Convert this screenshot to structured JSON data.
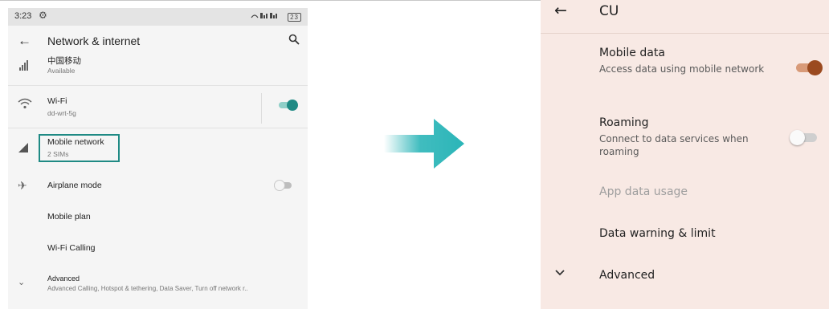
{
  "left_screen": {
    "status": {
      "time": "3:23",
      "icons": "⚓ ▐▐▌▐▐▌",
      "battery": "23"
    },
    "header": {
      "title": "Network & internet"
    },
    "items": {
      "sim": {
        "title": "中国移动",
        "subtitle": "Available"
      },
      "wifi": {
        "title": "Wi-Fi",
        "subtitle": "dd-wrt-5g",
        "toggle_on": true
      },
      "mobile": {
        "title": "Mobile network",
        "subtitle": "2 SIMs"
      },
      "airplane": {
        "title": "Airplane mode",
        "toggle_on": false
      },
      "mobile_plan": {
        "title": "Mobile plan"
      },
      "wifi_calling": {
        "title": "Wi-Fi Calling"
      },
      "advanced": {
        "title": "Advanced",
        "subtitle": "Advanced Calling, Hotspot & tethering, Data Saver, Turn off network r.."
      }
    }
  },
  "right_screen": {
    "header": {
      "title": "CU"
    },
    "mobile_data": {
      "title": "Mobile data",
      "subtitle": "Access data using mobile network",
      "toggle_on": true
    },
    "roaming": {
      "title": "Roaming",
      "subtitle": "Connect to data services when roaming",
      "toggle_on": false
    },
    "app_data_usage": {
      "title": "App data usage"
    },
    "data_warning": {
      "title": "Data warning & limit"
    },
    "advanced": {
      "title": "Advanced"
    }
  },
  "colors": {
    "teal_accent": "#1f8a84",
    "arrow": "#2bb5b8",
    "brown_toggle": "#9b4a1f",
    "right_background": "#f8e9e4"
  }
}
